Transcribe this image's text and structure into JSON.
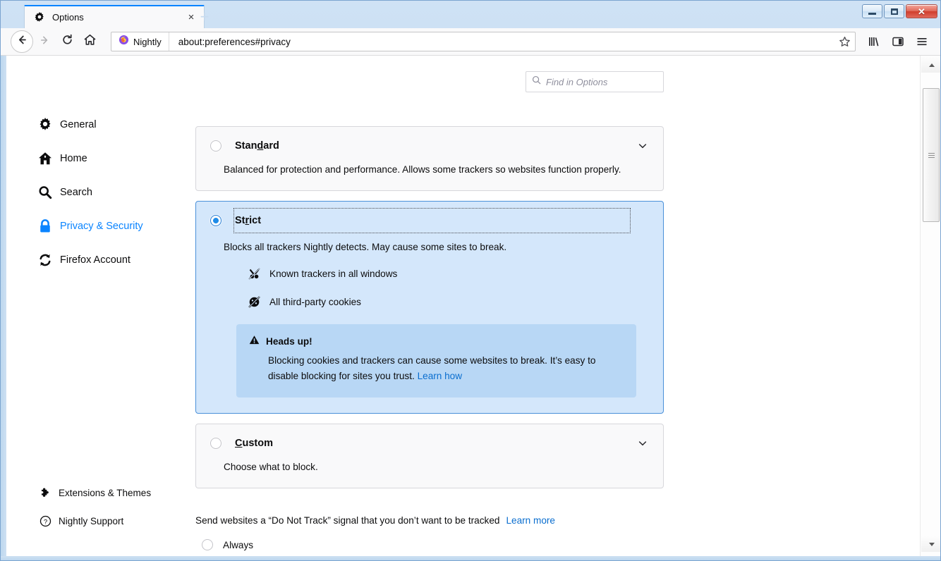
{
  "window": {
    "minimize_label": "Minimize",
    "maximize_label": "Maximize",
    "close_label": "Close"
  },
  "tabs": [
    {
      "title": "Options",
      "icon": "gear-icon",
      "close_label": "×",
      "active": true
    }
  ],
  "newtab_label": "+",
  "toolbar": {
    "back_label": "←",
    "forward_label": "→",
    "reload_label": "↻",
    "home_label": "Home",
    "identity_label": "Nightly",
    "url": "about:preferences#privacy",
    "bookmark_label": "Bookmark this page",
    "library_label": "Library",
    "sidebar_label": "Sidebars",
    "menu_label": "Open menu"
  },
  "search": {
    "placeholder": "Find in Options",
    "value": ""
  },
  "sidebar": {
    "items": [
      {
        "label": "General",
        "icon": "gear-icon",
        "selected": false
      },
      {
        "label": "Home",
        "icon": "home-icon",
        "selected": false
      },
      {
        "label": "Search",
        "icon": "search-icon",
        "selected": false
      },
      {
        "label": "Privacy & Security",
        "icon": "lock-icon",
        "selected": true
      },
      {
        "label": "Firefox Account",
        "icon": "sync-icon",
        "selected": false
      }
    ],
    "bottom_items": [
      {
        "label": "Extensions & Themes",
        "icon": "puzzle-icon"
      },
      {
        "label": "Nightly Support",
        "icon": "question-circle-icon"
      }
    ]
  },
  "main": {
    "cards": [
      {
        "id": "standard",
        "title_pre": "Stan",
        "title_key": "d",
        "title_post": "ard",
        "selected": false,
        "description": "Balanced for protection and performance. Allows some trackers so websites function properly.",
        "chevron": "chevron-down-icon"
      },
      {
        "id": "strict",
        "title_pre": "St",
        "title_key": "r",
        "title_post": "ict",
        "selected": true,
        "description": "Blocks all trackers Nightly detects. May cause some sites to break.",
        "features": [
          {
            "label": "Known trackers in all windows",
            "icon": "tracker-blocked-icon"
          },
          {
            "label": "All third-party cookies",
            "icon": "cookie-blocked-icon"
          }
        ],
        "warning": {
          "icon": "warning-triangle-icon",
          "title": "Heads up!",
          "body": "Blocking cookies and trackers can cause some websites to break. It’s easy to disable blocking for sites you trust.",
          "link": "Learn how"
        }
      },
      {
        "id": "custom",
        "title_pre": "",
        "title_key": "C",
        "title_post": "ustom",
        "selected": false,
        "description": "Choose what to block.",
        "chevron": "chevron-down-icon"
      }
    ],
    "do_not_track": {
      "text": "Send websites a “Do Not Track” signal that you don’t want to be tracked",
      "link": "Learn more",
      "option_label": "Always",
      "option_checked": false
    }
  },
  "colors": {
    "accent": "#0a84ff",
    "selected_card_bg": "#d4e7fb",
    "selected_card_border": "#4a90d9",
    "warning_bg": "#b8d7f5",
    "link": "#0a6ecf",
    "card_bg": "#f9f9fa",
    "card_border": "#d7d7db"
  },
  "scrollbar": {
    "up_label": "Scroll up",
    "down_label": "Scroll down",
    "thumb_label": "Scroll thumb"
  }
}
